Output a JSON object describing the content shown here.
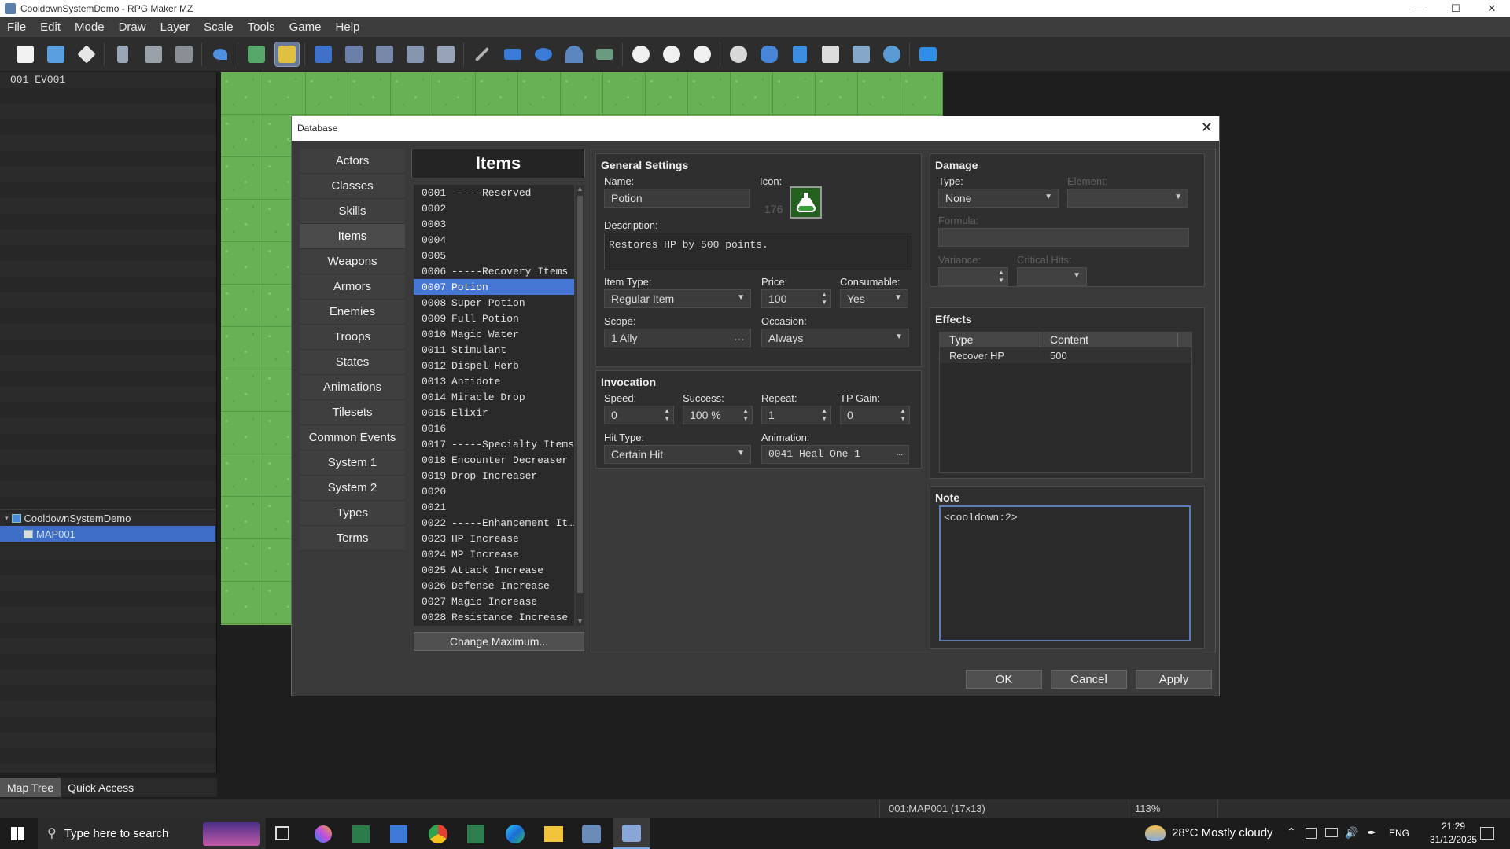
{
  "window": {
    "title": "CooldownSystemDemo - RPG Maker MZ"
  },
  "menu": [
    "File",
    "Edit",
    "Mode",
    "Draw",
    "Layer",
    "Scale",
    "Tools",
    "Game",
    "Help"
  ],
  "events": [
    "001 EV001"
  ],
  "maptree": {
    "project": "CooldownSystemDemo",
    "map": "MAP001"
  },
  "bottomtabs": {
    "map_tree": "Map Tree",
    "quick_access": "Quick Access"
  },
  "status": {
    "map": "001:MAP001 (17x13)",
    "zoom": "113%"
  },
  "taskbar": {
    "search": "Type here to search",
    "weather": "28°C  Mostly cloudy",
    "lang": "ENG",
    "time": "21:29",
    "date": "31/12/2025"
  },
  "dialog": {
    "title": "Database",
    "categories": [
      "Actors",
      "Classes",
      "Skills",
      "Items",
      "Weapons",
      "Armors",
      "Enemies",
      "Troops",
      "States",
      "Animations",
      "Tilesets",
      "Common Events",
      "System 1",
      "System 2",
      "Types",
      "Terms"
    ],
    "list_title": "Items",
    "items": [
      {
        "num": "0001",
        "name": "-----Reserved"
      },
      {
        "num": "0002",
        "name": ""
      },
      {
        "num": "0003",
        "name": ""
      },
      {
        "num": "0004",
        "name": ""
      },
      {
        "num": "0005",
        "name": ""
      },
      {
        "num": "0006",
        "name": "-----Recovery Items"
      },
      {
        "num": "0007",
        "name": "Potion"
      },
      {
        "num": "0008",
        "name": "Super Potion"
      },
      {
        "num": "0009",
        "name": "Full Potion"
      },
      {
        "num": "0010",
        "name": "Magic Water"
      },
      {
        "num": "0011",
        "name": "Stimulant"
      },
      {
        "num": "0012",
        "name": "Dispel Herb"
      },
      {
        "num": "0013",
        "name": "Antidote"
      },
      {
        "num": "0014",
        "name": "Miracle Drop"
      },
      {
        "num": "0015",
        "name": "Elixir"
      },
      {
        "num": "0016",
        "name": ""
      },
      {
        "num": "0017",
        "name": "-----Specialty Items"
      },
      {
        "num": "0018",
        "name": "Encounter Decreaser"
      },
      {
        "num": "0019",
        "name": "Drop Increaser"
      },
      {
        "num": "0020",
        "name": ""
      },
      {
        "num": "0021",
        "name": ""
      },
      {
        "num": "0022",
        "name": "-----Enhancement It…"
      },
      {
        "num": "0023",
        "name": "HP Increase"
      },
      {
        "num": "0024",
        "name": "MP Increase"
      },
      {
        "num": "0025",
        "name": "Attack Increase"
      },
      {
        "num": "0026",
        "name": "Defense Increase"
      },
      {
        "num": "0027",
        "name": "Magic Increase"
      },
      {
        "num": "0028",
        "name": "Resistance Increase"
      }
    ],
    "change_max": "Change Maximum...",
    "general": {
      "title": "General Settings",
      "name_label": "Name:",
      "name_value": "Potion",
      "icon_label": "Icon:",
      "icon_index": "176",
      "desc_label": "Description:",
      "desc_value": "Restores HP by 500 points.",
      "itemtype_label": "Item Type:",
      "itemtype_value": "Regular Item",
      "price_label": "Price:",
      "price_value": "100",
      "consumable_label": "Consumable:",
      "consumable_value": "Yes",
      "scope_label": "Scope:",
      "scope_value": "1 Ally",
      "occasion_label": "Occasion:",
      "occasion_value": "Always"
    },
    "invocation": {
      "title": "Invocation",
      "speed_label": "Speed:",
      "speed_value": "0",
      "success_label": "Success:",
      "success_value": "100 %",
      "repeat_label": "Repeat:",
      "repeat_value": "1",
      "tpgain_label": "TP Gain:",
      "tpgain_value": "0",
      "hittype_label": "Hit Type:",
      "hittype_value": "Certain Hit",
      "animation_label": "Animation:",
      "animation_value": "0041 Heal One 1"
    },
    "damage": {
      "title": "Damage",
      "type_label": "Type:",
      "type_value": "None",
      "element_label": "Element:",
      "formula_label": "Formula:",
      "variance_label": "Variance:",
      "critical_label": "Critical Hits:"
    },
    "effects": {
      "title": "Effects",
      "col_type": "Type",
      "col_content": "Content",
      "rows": [
        {
          "type": "Recover HP",
          "content": "500"
        }
      ]
    },
    "note": {
      "title": "Note",
      "value": "<cooldown:2>"
    },
    "buttons": {
      "ok": "OK",
      "cancel": "Cancel",
      "apply": "Apply"
    }
  }
}
